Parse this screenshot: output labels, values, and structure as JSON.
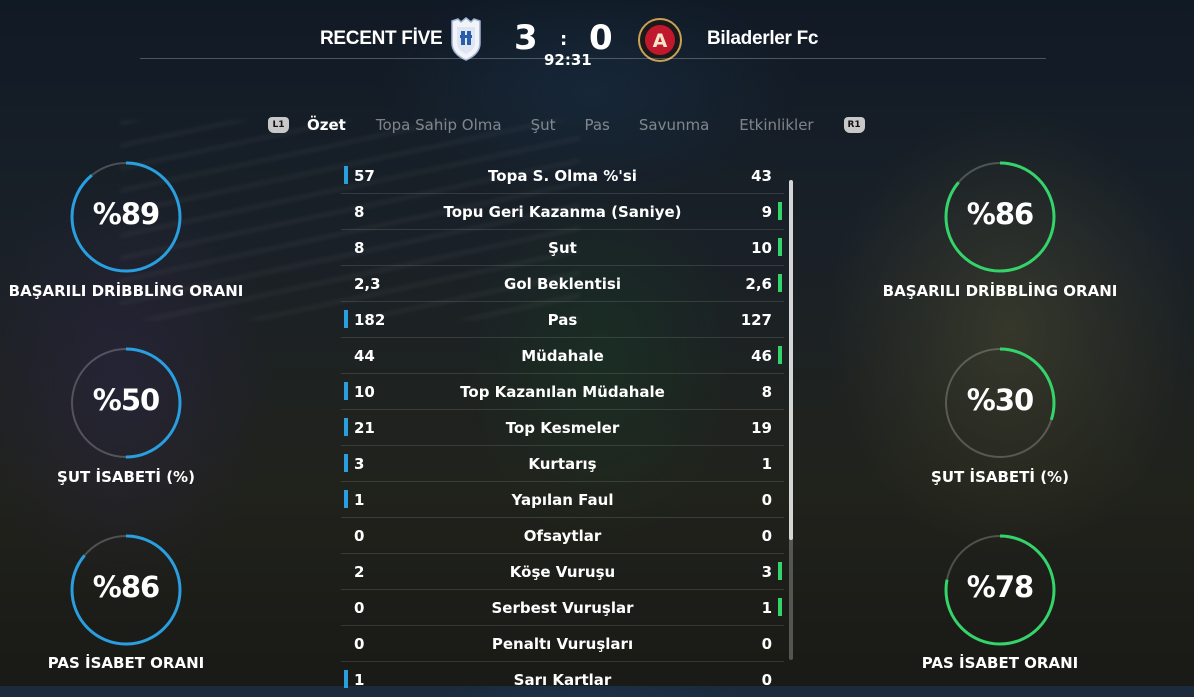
{
  "header": {
    "home_team": "RECENT FİVE",
    "away_team": "Biladerler Fc",
    "home_score": "3",
    "separator": ":",
    "away_score": "0",
    "clock": "92:31",
    "home_crest_icon": "home-club-shield-crest-icon",
    "away_crest_icon": "atlanta-united-crest-icon",
    "away_crest_letter": "A"
  },
  "tabs": {
    "left_button": "L1",
    "right_button": "R1",
    "items": [
      {
        "label": "Özet",
        "active": true
      },
      {
        "label": "Topa Sahip Olma",
        "active": false
      },
      {
        "label": "Şut",
        "active": false
      },
      {
        "label": "Pas",
        "active": false
      },
      {
        "label": "Savunma",
        "active": false
      },
      {
        "label": "Etkinlikler",
        "active": false
      }
    ]
  },
  "colors": {
    "home_accent": "#2a9fe0",
    "away_accent": "#35d46a"
  },
  "stats": [
    {
      "label": "Topa S. Olma %'si",
      "home": "57",
      "away": "43",
      "leader": "home"
    },
    {
      "label": "Topu Geri Kazanma (Saniye)",
      "home": "8",
      "away": "9",
      "leader": "away"
    },
    {
      "label": "Şut",
      "home": "8",
      "away": "10",
      "leader": "away"
    },
    {
      "label": "Gol Beklentisi",
      "home": "2,3",
      "away": "2,6",
      "leader": "away"
    },
    {
      "label": "Pas",
      "home": "182",
      "away": "127",
      "leader": "home"
    },
    {
      "label": "Müdahale",
      "home": "44",
      "away": "46",
      "leader": "away"
    },
    {
      "label": "Top Kazanılan Müdahale",
      "home": "10",
      "away": "8",
      "leader": "home"
    },
    {
      "label": "Top Kesmeler",
      "home": "21",
      "away": "19",
      "leader": "home"
    },
    {
      "label": "Kurtarış",
      "home": "3",
      "away": "1",
      "leader": "home"
    },
    {
      "label": "Yapılan Faul",
      "home": "1",
      "away": "0",
      "leader": "home"
    },
    {
      "label": "Ofsaytlar",
      "home": "0",
      "away": "0",
      "leader": "none"
    },
    {
      "label": "Köşe Vuruşu",
      "home": "2",
      "away": "3",
      "leader": "away"
    },
    {
      "label": "Serbest Vuruşlar",
      "home": "0",
      "away": "1",
      "leader": "away"
    },
    {
      "label": "Penaltı Vuruşları",
      "home": "0",
      "away": "0",
      "leader": "none"
    },
    {
      "label": "Sarı Kartlar",
      "home": "1",
      "away": "0",
      "leader": "home"
    }
  ],
  "rings": {
    "home": [
      {
        "value": "%89",
        "fraction": 0.89,
        "label": "BAŞARILI DRİBBLİNG ORANI"
      },
      {
        "value": "%50",
        "fraction": 0.5,
        "label": "ŞUT İSABETİ (%)"
      },
      {
        "value": "%86",
        "fraction": 0.86,
        "label": "PAS İSABET ORANI"
      }
    ],
    "away": [
      {
        "value": "%86",
        "fraction": 0.86,
        "label": "BAŞARILI DRİBBLİNG ORANI"
      },
      {
        "value": "%30",
        "fraction": 0.3,
        "label": "ŞUT İSABETİ (%)"
      },
      {
        "value": "%78",
        "fraction": 0.78,
        "label": "PAS İSABET ORANI"
      }
    ]
  }
}
